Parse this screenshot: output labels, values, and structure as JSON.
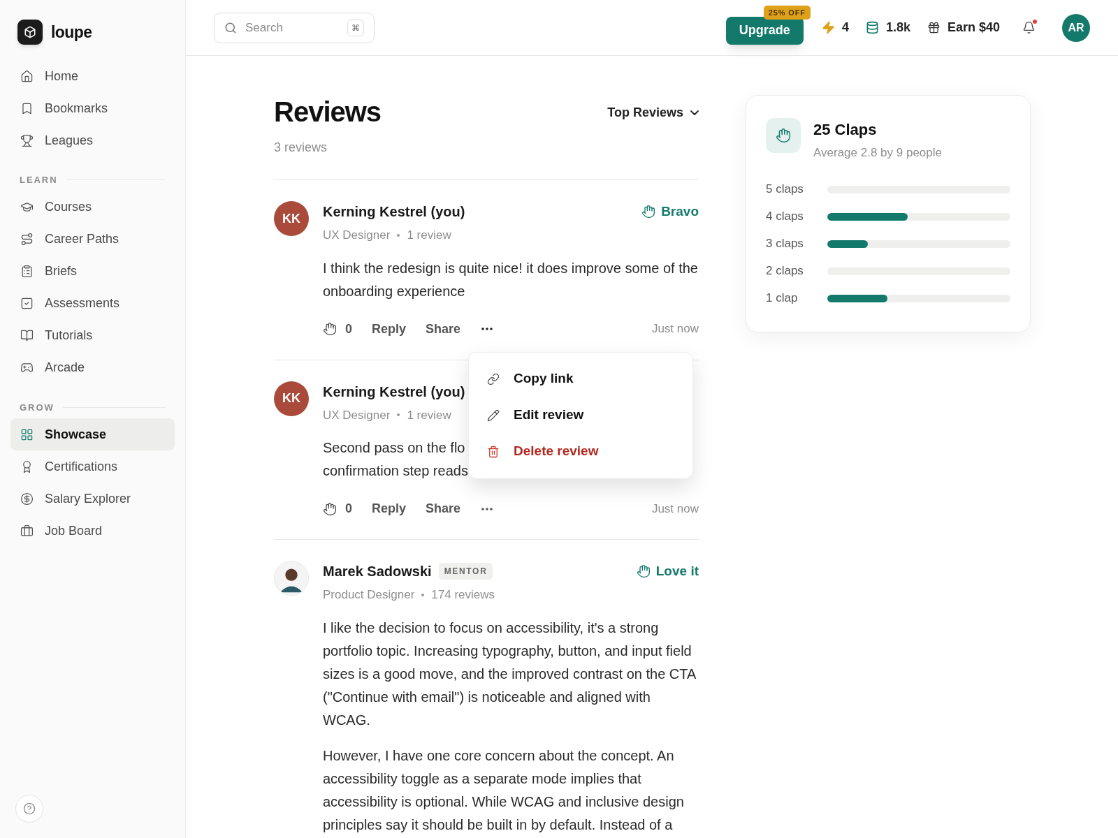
{
  "brand": {
    "name": "loupe"
  },
  "sidebar": {
    "groups": [
      {
        "items": [
          {
            "label": "Home",
            "selected": false
          },
          {
            "label": "Bookmarks",
            "selected": false
          },
          {
            "label": "Leagues",
            "selected": false
          }
        ]
      },
      {
        "heading": "LEARN",
        "items": [
          {
            "label": "Courses",
            "selected": false
          },
          {
            "label": "Career Paths",
            "selected": false
          },
          {
            "label": "Briefs",
            "selected": false
          },
          {
            "label": "Assessments",
            "selected": false
          },
          {
            "label": "Tutorials",
            "selected": false
          },
          {
            "label": "Arcade",
            "selected": false
          }
        ]
      },
      {
        "heading": "GROW",
        "items": [
          {
            "label": "Showcase",
            "selected": true
          },
          {
            "label": "Certifications",
            "selected": false
          },
          {
            "label": "Salary Explorer",
            "selected": false
          },
          {
            "label": "Job Board",
            "selected": false
          }
        ]
      }
    ]
  },
  "header": {
    "search": {
      "placeholder": "Search",
      "shortcut": "⌘"
    },
    "upgrade": {
      "label": "Upgrade",
      "badge": "25% OFF"
    },
    "streak": "4",
    "coins": "1.8k",
    "earn": "Earn $40",
    "notifications": {
      "unread": true
    },
    "avatar": "AR"
  },
  "reviews": {
    "title": "Reviews",
    "count": "3 reviews",
    "sort": "Top Reviews",
    "items": [
      {
        "avatar": {
          "kind": "initials",
          "text": "KK"
        },
        "author": "Kerning Kestrel (you)",
        "role": "UX Designer",
        "review_count": "1 review",
        "reaction": "Bravo",
        "paragraphs": [
          [
            "I think the redesign is quite nice! it does improve some of the onboarding experience"
          ]
        ],
        "claps": "0",
        "reply": "Reply",
        "share": "Share",
        "time": "Just now",
        "menu_open": true
      },
      {
        "avatar": {
          "kind": "initials",
          "text": "KK"
        },
        "author": "Kerning Kestrel (you)",
        "role": "UX Designer",
        "review_count": "1 review",
        "paragraphs": [
          [
            "Second pass on the flo",
            "confirmation step reads"
          ]
        ],
        "claps": "0",
        "reply": "Reply",
        "share": "Share",
        "time": "Just now",
        "menu_open": false
      },
      {
        "avatar": {
          "kind": "photo"
        },
        "author": "Marek Sadowski",
        "badge": "MENTOR",
        "role": "Product Designer",
        "review_count": "174 reviews",
        "reaction": "Love it",
        "paragraphs": [
          [
            "I like the decision to focus on accessibility, it's a strong portfolio topic. Increasing typography, button, and input field sizes is a good move, and the improved contrast on the CTA (\"Continue with email\") is noticeable and aligned with WCAG."
          ],
          [
            "However, I have one core concern about the concept. An accessibility toggle as a separate mode implies that accessibility is optional. While WCAG and inclusive design principles say it should be built in by default. Instead of a"
          ]
        ]
      }
    ]
  },
  "menu": {
    "items": [
      {
        "label": "Copy link",
        "kind": "link"
      },
      {
        "label": "Edit review",
        "kind": "edit"
      },
      {
        "label": "Delete review",
        "kind": "delete"
      }
    ]
  },
  "claps_summary": {
    "title": "25 Claps",
    "subtitle": "Average 2.8 by 9 people",
    "rows": [
      {
        "label": "5 claps",
        "level": 0
      },
      {
        "label": "4 claps",
        "level": 0.44
      },
      {
        "label": "3 claps",
        "level": 0.22
      },
      {
        "label": "2 claps",
        "level": 0
      },
      {
        "label": "1 clap",
        "level": 0.33
      }
    ]
  }
}
